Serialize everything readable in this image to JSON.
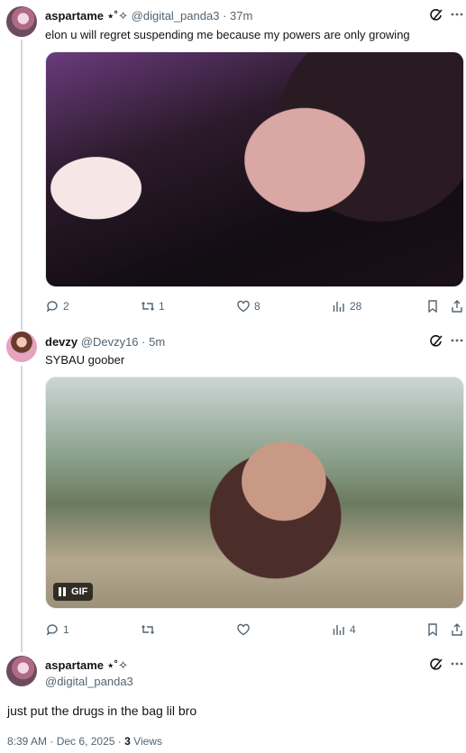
{
  "tweets": [
    {
      "name": "aspartame",
      "badges": "⋆˚✧",
      "handle": "@digital_panda3",
      "time": "37m",
      "separator": "·",
      "text": "elon u will regret suspending me because my powers are only growing",
      "stats": {
        "replies": "2",
        "reposts": "1",
        "likes": "8",
        "views": "28"
      }
    },
    {
      "name": "devzy",
      "handle": "@Devzy16",
      "time": "5m",
      "separator": "·",
      "text": "SYBAU goober",
      "gif_label": "GIF",
      "stats": {
        "replies": "1",
        "views": "4"
      }
    }
  ],
  "main": {
    "name": "aspartame",
    "badges": "⋆˚✧",
    "handle": "@digital_panda3",
    "text": "just put the drugs in the bag lil bro",
    "time": "8:39 AM",
    "date": "Dec 6, 2025",
    "separator": "·",
    "views_count": "3",
    "views_label": "Views"
  },
  "icons": [
    "grok-icon",
    "more-icon",
    "reply-icon",
    "repost-icon",
    "like-icon",
    "views-icon",
    "bookmark-icon",
    "share-icon",
    "pause-icon"
  ],
  "colors": {
    "text": "#0f1419",
    "secondary": "#536471",
    "line": "#cfd9de"
  }
}
